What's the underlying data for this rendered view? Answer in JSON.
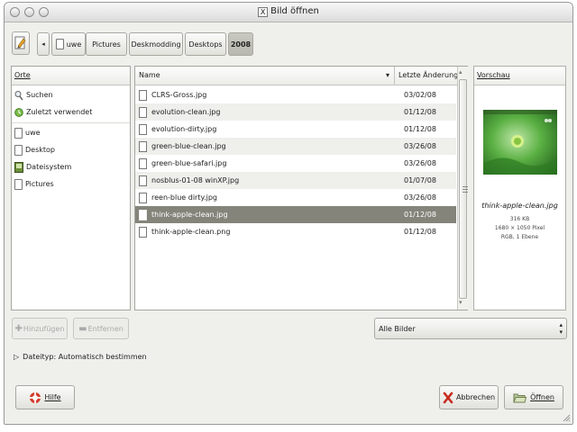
{
  "window": {
    "title": "Bild öffnen"
  },
  "pathbar": {
    "segments": [
      "uwe",
      "Pictures",
      "Deskmodding",
      "Desktops",
      "2008"
    ],
    "active": "2008"
  },
  "places": {
    "header": "Orte",
    "items": [
      {
        "label": "Suchen",
        "icon": "search-icon"
      },
      {
        "label": "Zuletzt verwendet",
        "icon": "recent-icon"
      },
      {
        "label": "uwe",
        "icon": "file-icon"
      },
      {
        "label": "Desktop",
        "icon": "file-icon"
      },
      {
        "label": "Dateisystem",
        "icon": "drive-icon"
      },
      {
        "label": "Pictures",
        "icon": "file-icon"
      }
    ]
  },
  "files": {
    "col_name": "Name",
    "col_date": "Letzte Änderung",
    "rows": [
      {
        "name": "CLRS-Gross.jpg",
        "date": "03/02/08"
      },
      {
        "name": "evolution-clean.jpg",
        "date": "01/12/08"
      },
      {
        "name": "evolution-dirty.jpg",
        "date": "01/12/08"
      },
      {
        "name": "green-blue-clean.jpg",
        "date": "03/26/08"
      },
      {
        "name": "green-blue-safari.jpg",
        "date": "03/26/08"
      },
      {
        "name": "nosblus-01-08 winXP.jpg",
        "date": "01/07/08"
      },
      {
        "name": "reen-blue dirty.jpg",
        "date": "03/26/08"
      },
      {
        "name": "think-apple-clean.jpg",
        "date": "01/12/08",
        "selected": true
      },
      {
        "name": "think-apple-clean.png",
        "date": "01/12/08"
      }
    ]
  },
  "preview": {
    "header": "Vorschau",
    "filename": "think-apple-clean.jpg",
    "size": "316 KB",
    "dims": "1680 × 1050 Pixel",
    "info": "RGB, 1 Ebene"
  },
  "buttons": {
    "add": "Hinzufügen",
    "remove": "Entfernen",
    "help": "Hilfe",
    "cancel": "Abbrechen",
    "open": "Öffnen"
  },
  "filter": {
    "selected": "Alle Bilder"
  },
  "filetype": {
    "label": "Dateityp: Automatisch bestimmen"
  },
  "colors": {
    "selection": "#85847a",
    "accent": "#5aa23a"
  }
}
